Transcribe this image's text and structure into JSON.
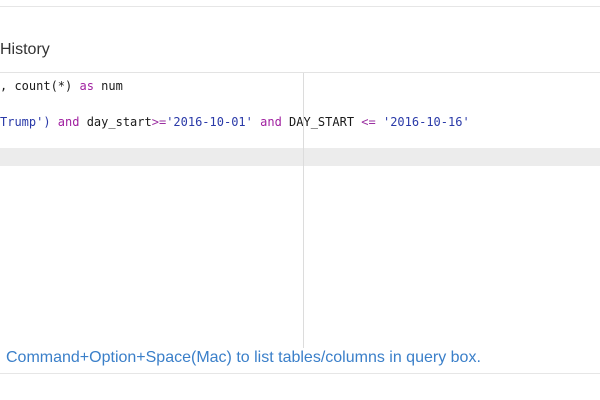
{
  "panel": {
    "title": "History"
  },
  "editor": {
    "line1": {
      "t1": ", count(*) ",
      "t2": "as",
      "t3": " num"
    },
    "line2": {
      "t1": "Trump') ",
      "t2": "and",
      "t3": " day_start",
      "t4": ">=",
      "t5": "'2016-10-01'",
      "t6": " ",
      "t7": "and",
      "t8": " DAY_START ",
      "t9": "<=",
      "t10": " ",
      "t11": "'2016-10-16'"
    }
  },
  "hint": {
    "text": "Command+Option+Space(Mac) to list tables/columns in query box."
  },
  "colors": {
    "keyword": "#a020a0",
    "string": "#2a3aa8",
    "hint_link": "#3a7fc9"
  }
}
